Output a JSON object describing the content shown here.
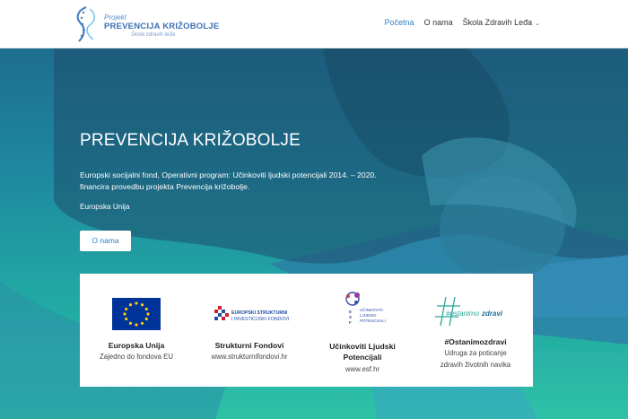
{
  "header": {
    "logo": {
      "small": "Projekt",
      "main": "PREVENCIJA KRIŽOBOLJE",
      "sub": "Škola zdravih leđa"
    },
    "nav": [
      {
        "label": "Početna",
        "active": true
      },
      {
        "label": "O nama",
        "active": false
      },
      {
        "label": "Škola Zdravih Leđa",
        "active": false,
        "has_dropdown": true
      }
    ]
  },
  "hero": {
    "title": "PREVENCIJA KRIŽOBOLJE",
    "text": "Europski socijalni fond, Operativni program: Učinkoviti ljudski potencijali 2014. – 2020. financira provedbu projekta Prevencija križobolje.",
    "eu_label": "Europska Unija",
    "button_label": "O nama"
  },
  "partners": [
    {
      "name": "Europska Unija",
      "desc": "Zajedno do fondova EU",
      "logo": "eu-flag-icon"
    },
    {
      "name": "Strukturni Fondovi",
      "desc": "www.strukturnifondovi.hr",
      "logo": "strukturni-fondovi-logo",
      "logo_text_1": "EUROPSKI STRUKTURNI",
      "logo_text_2": "I INVESTICIJSKI FONDOVI"
    },
    {
      "name": "Učinkoviti Ljudski Potencijali",
      "name_line1": "Učinkoviti Ljudski",
      "name_line2": "Potencijali",
      "desc": "www.esf.hr",
      "logo": "esf-logo",
      "logo_text_1": "UČINKOVITI",
      "logo_text_2": "LJUDSKI",
      "logo_text_3": "POTENCIJALI"
    },
    {
      "name": "#Ostanimozdravi",
      "desc": "Udruga za poticanje zdravih životnih navika",
      "desc_line1": "Udruga za poticanje",
      "desc_line2": "zdravih životnih navika",
      "logo": "ostanimozdravi-logo",
      "logo_text_1": "#ostanimo",
      "logo_text_2": "zdravi"
    }
  ],
  "colors": {
    "accent": "#2e7fc7",
    "hero_top": "#1e6d8f",
    "hero_bottom": "#25c0a2",
    "eu_blue": "#003399",
    "eu_yellow": "#ffcc00",
    "osta_green": "#2aa89a"
  }
}
